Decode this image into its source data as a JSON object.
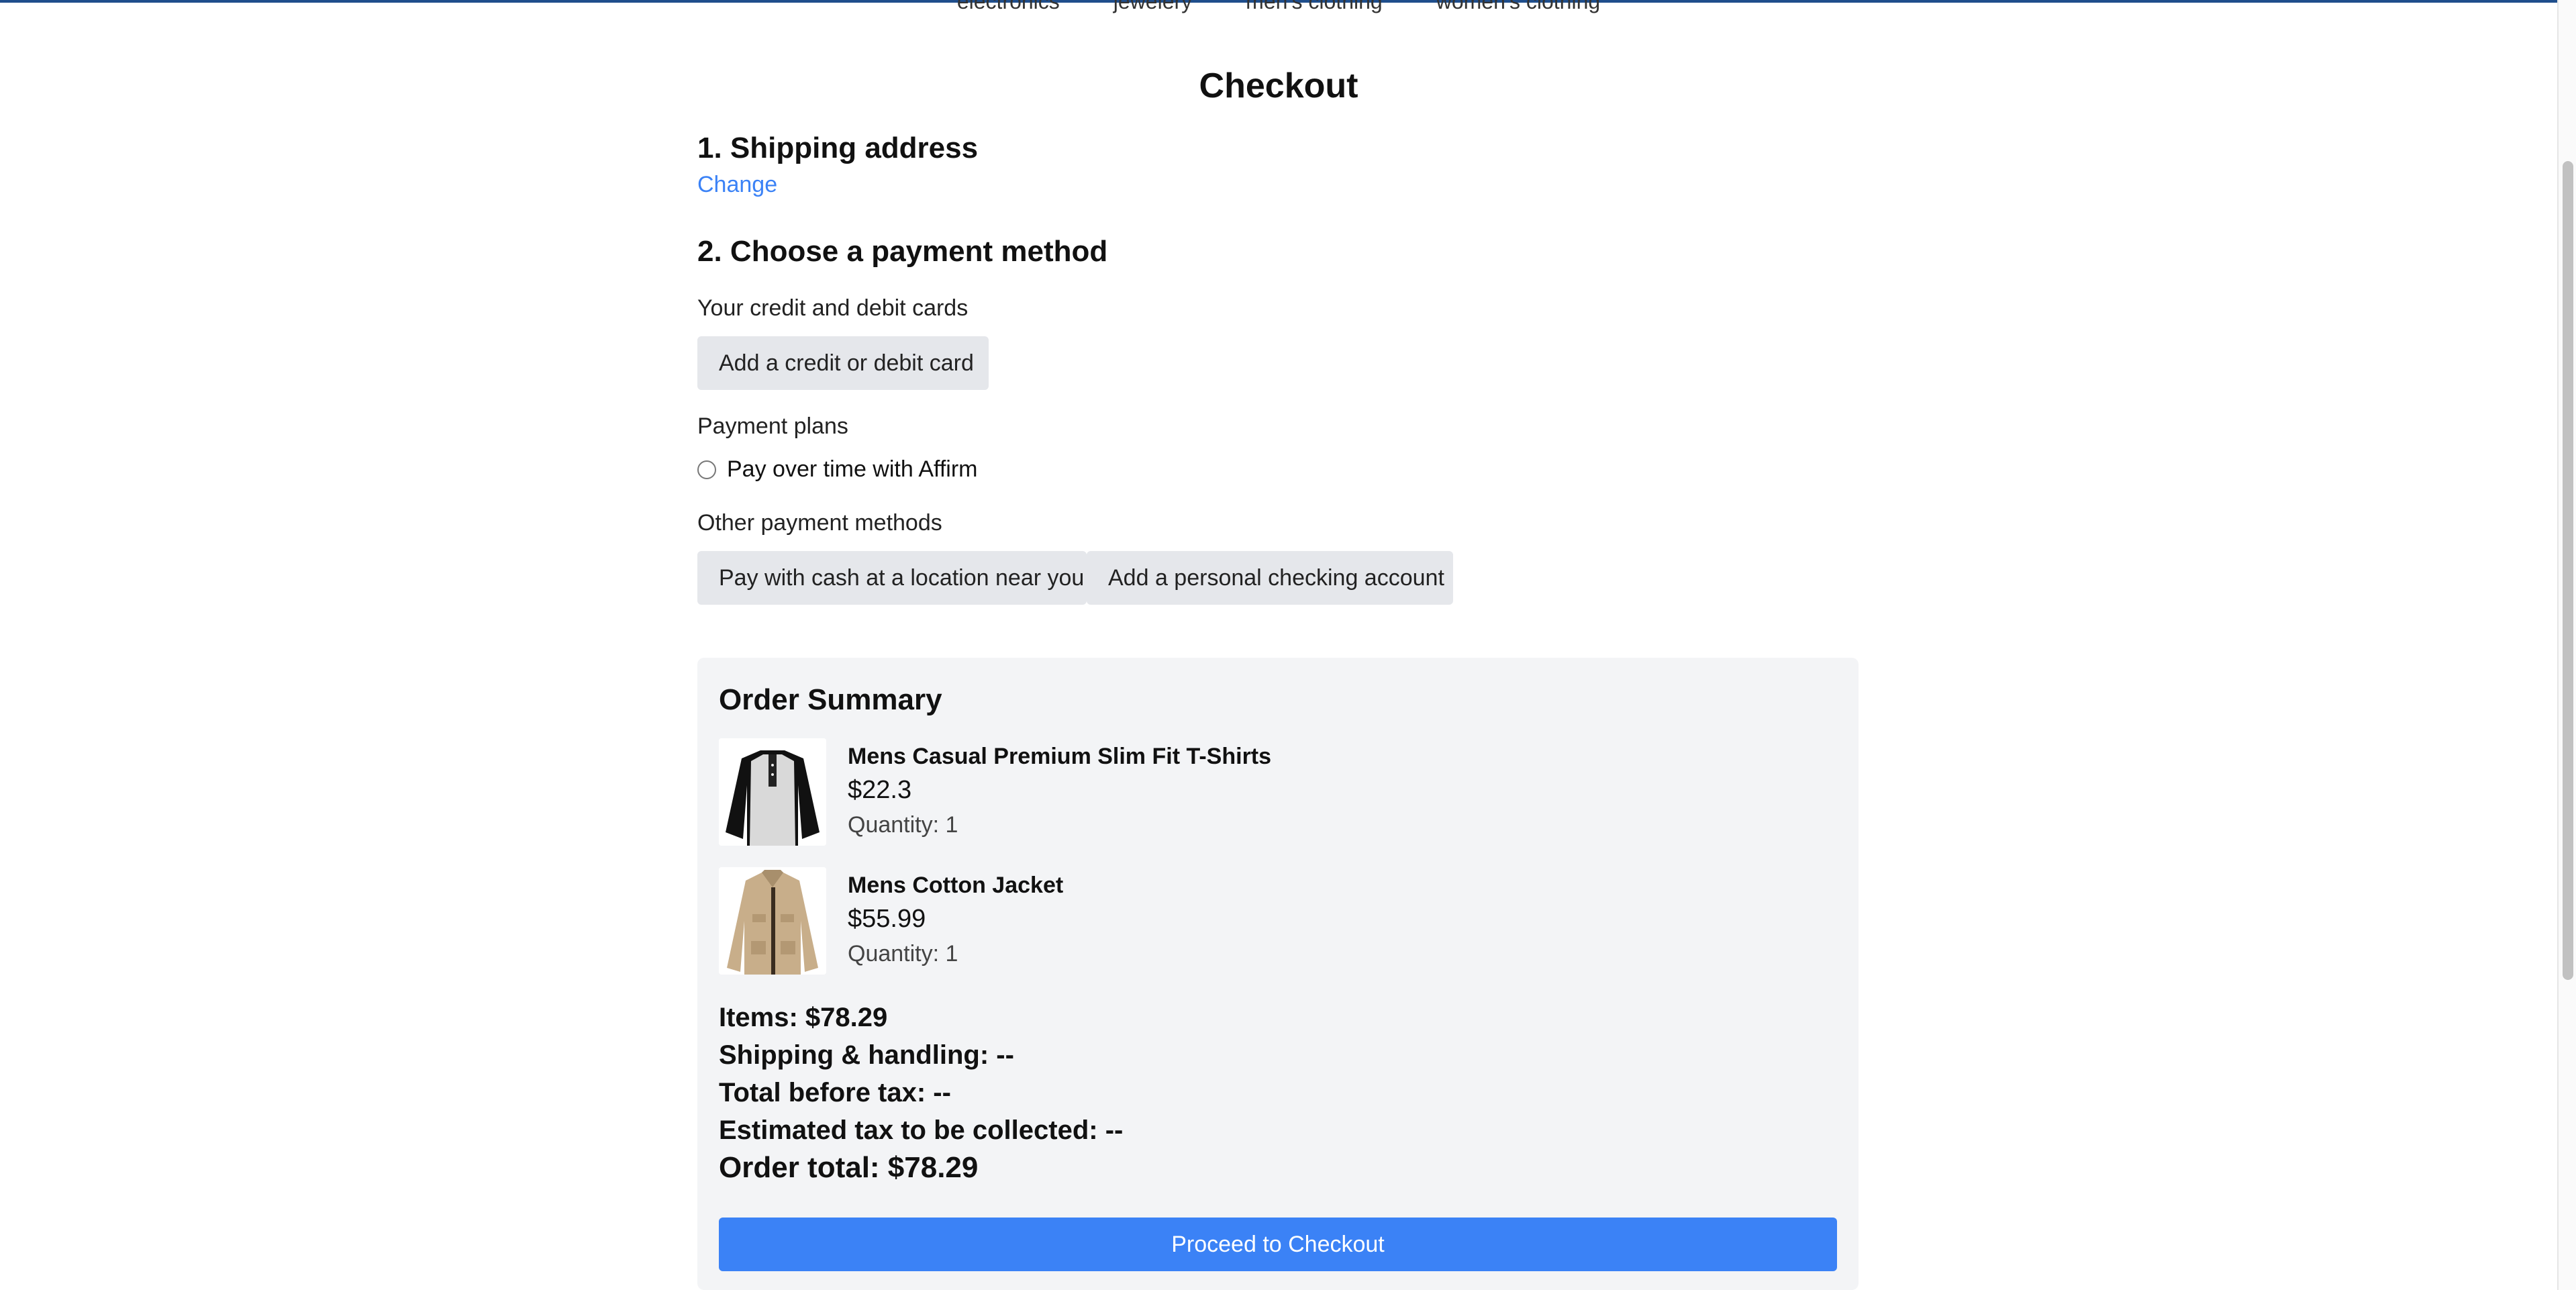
{
  "nav": [
    "electronics",
    "jewelery",
    "men's clothing",
    "women's clothing"
  ],
  "page": {
    "title": "Checkout"
  },
  "shipping": {
    "heading": "1. Shipping address",
    "change_link": "Change"
  },
  "payment": {
    "heading": "2. Choose a payment method",
    "cards_label": "Your credit and debit cards",
    "add_card_button": "Add a credit or debit card",
    "plans_label": "Payment plans",
    "affirm_option": "Pay over time with Affirm",
    "other_label": "Other payment methods",
    "cash_button": "Pay with cash at a location near you",
    "checking_button": "Add a personal checking account"
  },
  "summary": {
    "heading": "Order Summary",
    "items": [
      {
        "name": "Mens Casual Premium Slim Fit T-Shirts",
        "price": "$22.3",
        "quantity": "Quantity: 1"
      },
      {
        "name": "Mens Cotton Jacket",
        "price": "$55.99",
        "quantity": "Quantity: 1"
      }
    ],
    "items_total": "Items: $78.29",
    "shipping_handling": "Shipping & handling: --",
    "total_before_tax": "Total before tax: --",
    "estimated_tax": "Estimated tax to be collected: --",
    "order_total": "Order total: $78.29",
    "proceed_button": "Proceed to Checkout"
  },
  "colors": {
    "link": "#3b82f6",
    "primary_button": "#3b82f6",
    "secondary_button": "#e5e7eb",
    "summary_bg": "#f3f4f6"
  }
}
